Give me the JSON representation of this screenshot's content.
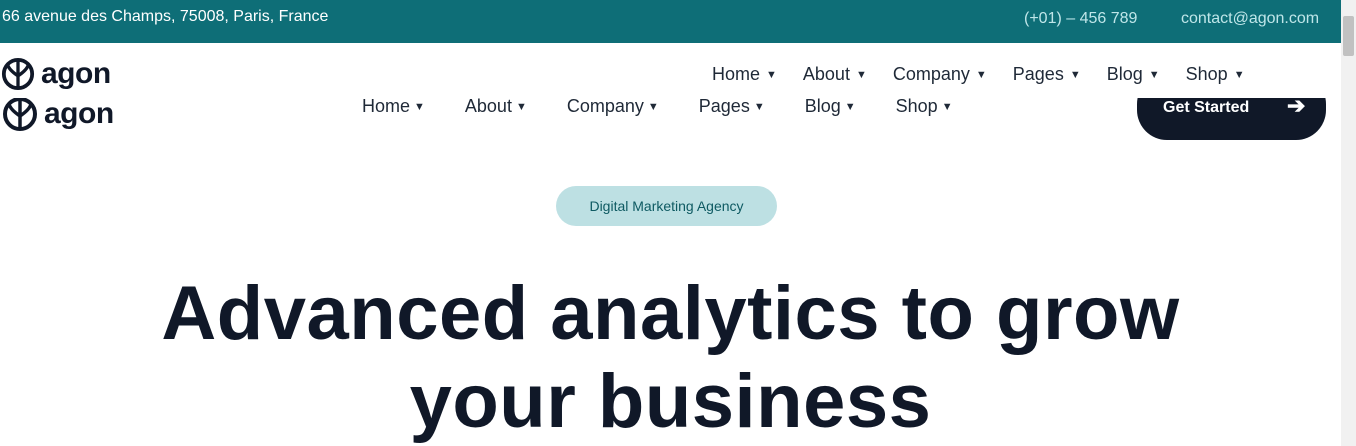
{
  "topbar": {
    "address": "66 avenue des Champs, 75008, Paris, France",
    "phone": "(+01) – 456 789",
    "email": "contact@agon.com"
  },
  "brand": {
    "name": "agon",
    "icon": "leaf-logo-icon"
  },
  "nav": {
    "items": [
      {
        "label": "Home"
      },
      {
        "label": "About"
      },
      {
        "label": "Company"
      },
      {
        "label": "Pages"
      },
      {
        "label": "Blog"
      },
      {
        "label": "Shop"
      }
    ]
  },
  "cta": {
    "label": "Get Started",
    "icon": "arrow-right-icon"
  },
  "hero": {
    "badge": "Digital Marketing Agency",
    "title_line1": "Advanced analytics to grow",
    "title_line2": "your business"
  },
  "colors": {
    "topbar_bg": "#0e6e77",
    "badge_bg": "#bde0e3",
    "dark": "#101828"
  }
}
